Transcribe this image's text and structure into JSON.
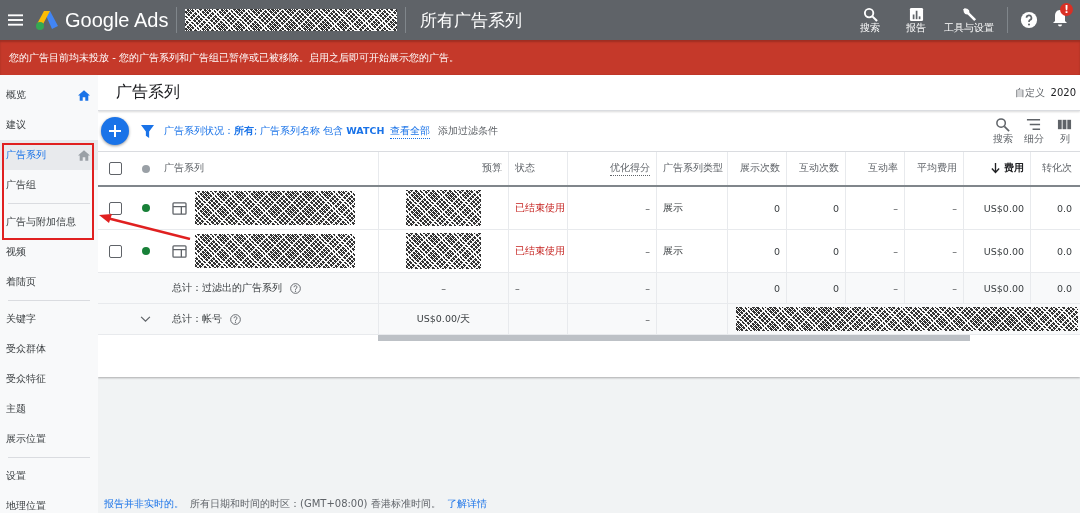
{
  "top_bar": {
    "product_name": "Google Ads",
    "page_title": "所有广告系列",
    "actions": [
      {
        "label": "搜索",
        "kind": "search"
      },
      {
        "label": "报告",
        "kind": "reports"
      },
      {
        "label": "工具与设置",
        "kind": "tools"
      }
    ],
    "notification_badge": "!"
  },
  "alert_banner": {
    "message": "您的广告目前均未投放 - 您的广告系列和广告组已暂停或已被移除。启用之后即可开始展示您的广告。"
  },
  "sidebar": {
    "groups": [
      [
        {
          "label": "概览",
          "selected": false,
          "home_icon": true
        },
        {
          "label": "建议",
          "selected": false,
          "home_icon": false
        },
        {
          "label": "广告系列",
          "selected": true,
          "home_icon": true
        },
        {
          "label": "广告组",
          "selected": false,
          "home_icon": false
        }
      ],
      [
        {
          "label": "广告与附加信息",
          "selected": false,
          "home_icon": false
        },
        {
          "label": "视频",
          "selected": false,
          "home_icon": false
        },
        {
          "label": "着陆页",
          "selected": false,
          "home_icon": false
        }
      ],
      [
        {
          "label": "关键字",
          "selected": false,
          "home_icon": false
        },
        {
          "label": "受众群体",
          "selected": false,
          "home_icon": false
        },
        {
          "label": "受众特征",
          "selected": false,
          "home_icon": false
        },
        {
          "label": "主题",
          "selected": false,
          "home_icon": false
        },
        {
          "label": "展示位置",
          "selected": false,
          "home_icon": false
        }
      ],
      [
        {
          "label": "设置",
          "selected": false,
          "home_icon": false
        },
        {
          "label": "地理位置",
          "selected": false,
          "home_icon": false
        }
      ]
    ]
  },
  "page": {
    "title": "广告系列",
    "date_range_label": "自定义",
    "date_range_value": "2020"
  },
  "filter_bar": {
    "filter_text": "广告系列状况：**所有**; 广告系列名称 包含 **WATCH**",
    "view_all_link": "查看全部",
    "add_filter": "添加过滤条件",
    "tools": [
      {
        "label": "搜索",
        "kind": "search"
      },
      {
        "label": "细分",
        "kind": "segment"
      },
      {
        "label": "列",
        "kind": "columns"
      }
    ]
  },
  "table": {
    "header_checked": false,
    "columns": [
      {
        "label": "广告系列",
        "sorted": false
      },
      {
        "label": "预算",
        "sorted": false
      },
      {
        "label": "状态",
        "sorted": false
      },
      {
        "label": "优化得分",
        "sorted": false
      },
      {
        "label": "广告系列类型",
        "sorted": false
      },
      {
        "label": "展示次数",
        "sorted": false
      },
      {
        "label": "互动次数",
        "sorted": false
      },
      {
        "label": "互动率",
        "sorted": false
      },
      {
        "label": "平均费用",
        "sorted": false
      },
      {
        "label": "费用",
        "sorted": true
      },
      {
        "label": "转化次",
        "sorted": false
      }
    ],
    "rows": [
      {
        "kind": "campaign",
        "checked": false,
        "color": "#188038",
        "cells": [
          "",
          "",
          "已结束使用",
          "–",
          "展示",
          "0",
          "0",
          "–",
          "–",
          "US$0.00",
          "0.0"
        ]
      },
      {
        "kind": "campaign",
        "checked": false,
        "color": "#188038",
        "cells": [
          "",
          "",
          "已结束使用",
          "–",
          "展示",
          "0",
          "0",
          "–",
          "–",
          "US$0.00",
          "0.0"
        ]
      },
      {
        "kind": "total",
        "cells": [
          "总计：过滤出的广告系列",
          "–",
          "–",
          "–",
          "",
          "0",
          "0",
          "–",
          "–",
          "US$0.00",
          "0.0"
        ]
      },
      {
        "kind": "account_total",
        "cells": [
          "总计：帐号",
          "US$0.00/天",
          "",
          "–",
          ""
        ]
      }
    ]
  },
  "footer": {
    "notice_link": "报告并非实时的。",
    "timezone_text": "所有日期和时间的时区：(GMT+08:00) 香港标准时间。",
    "learn_more_link": "了解详情"
  }
}
